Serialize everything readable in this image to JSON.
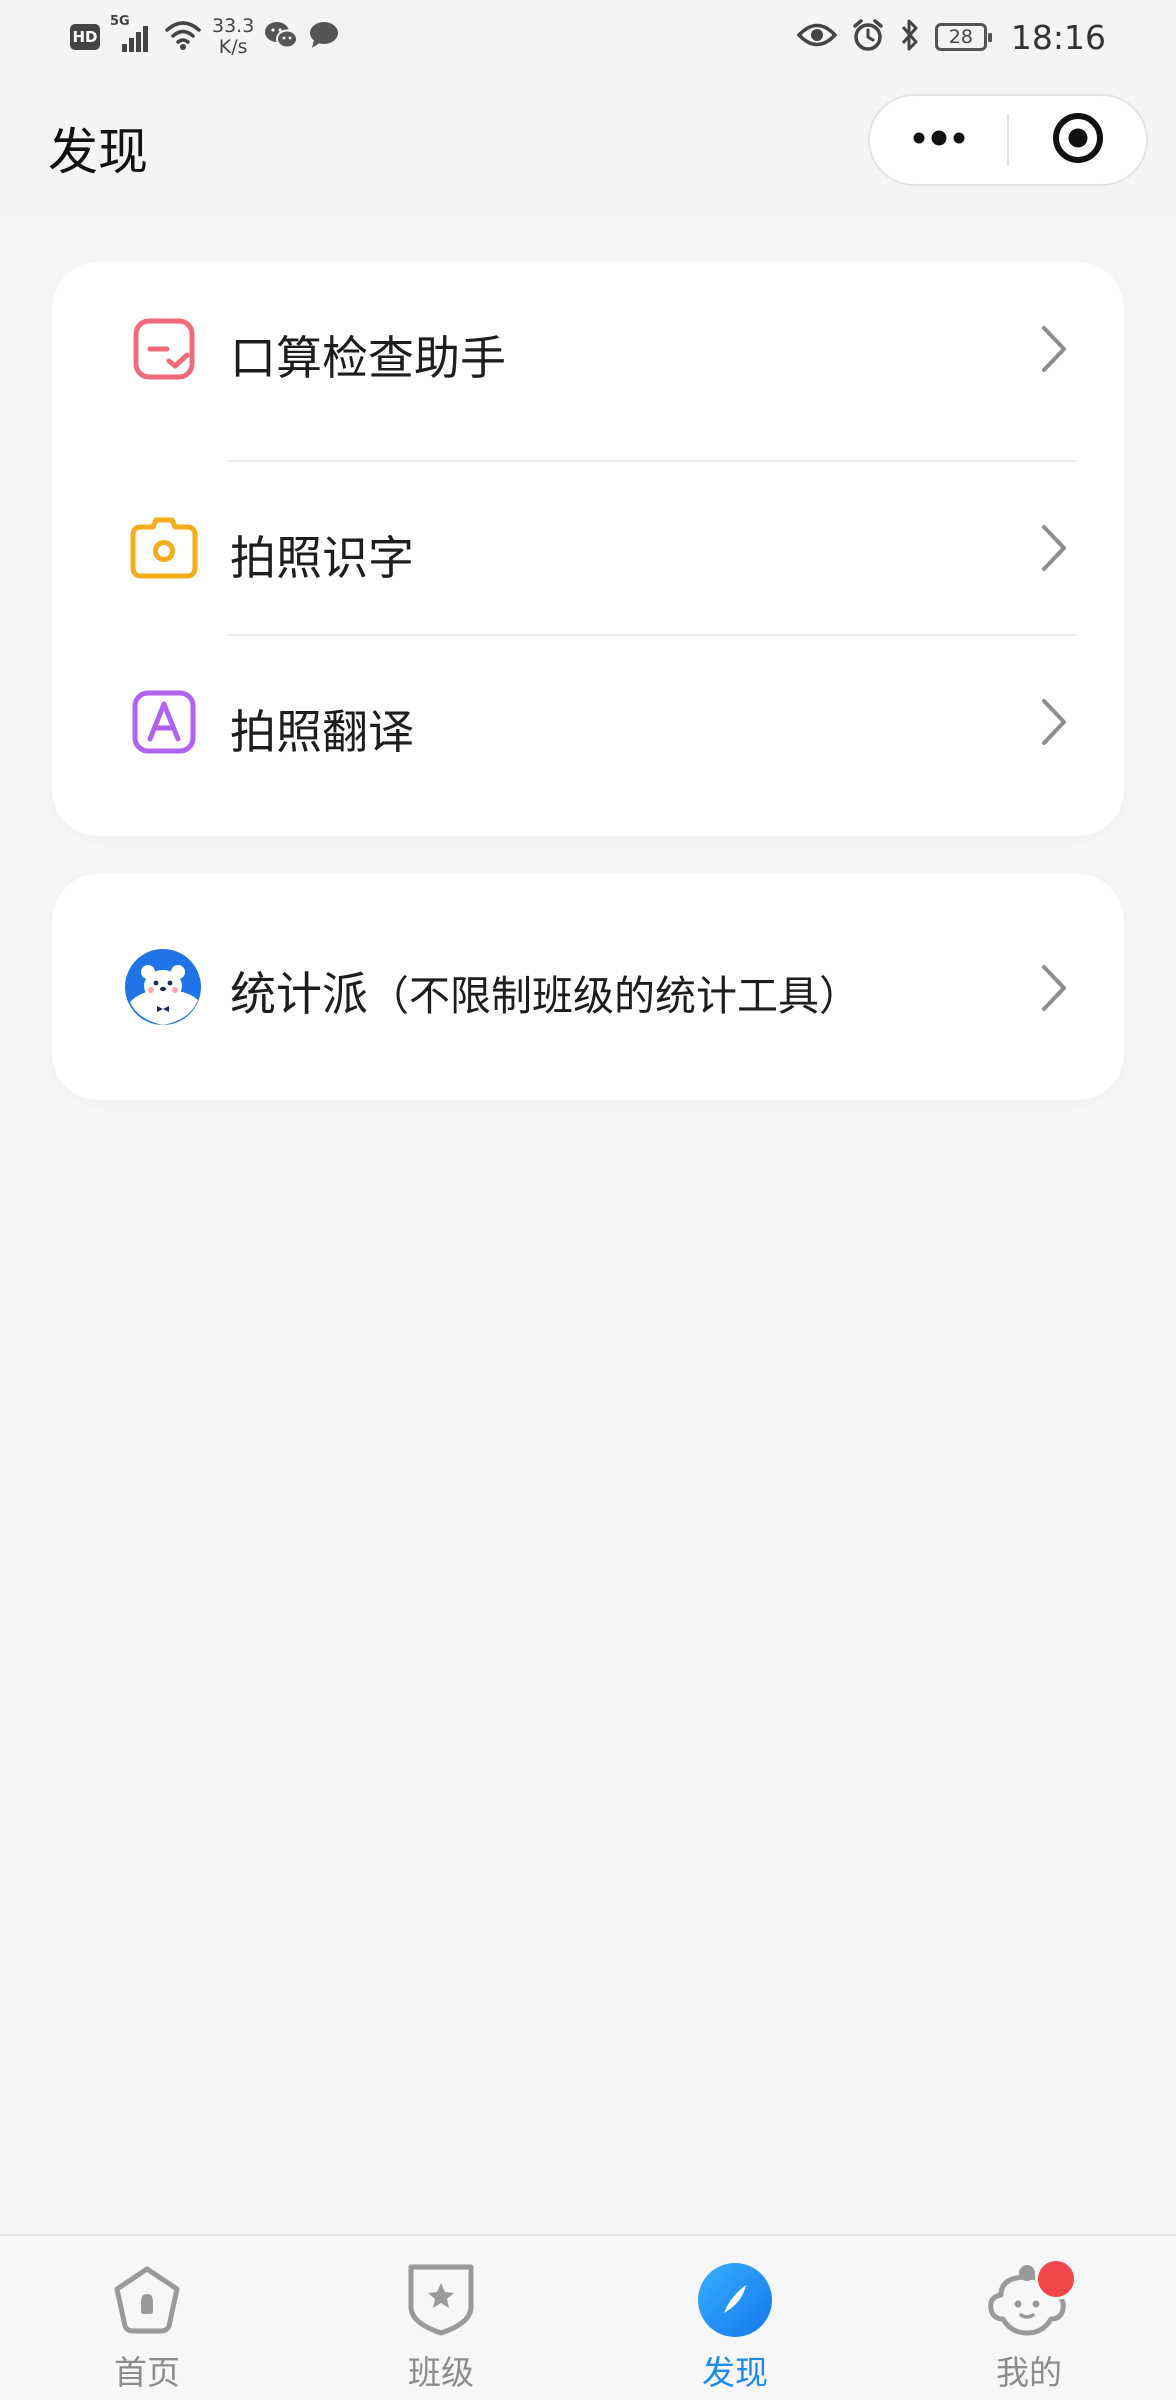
{
  "status_bar": {
    "hd_badge": "HD",
    "network_type": "5G",
    "net_speed_value": "33.3",
    "net_speed_unit": "K/s",
    "battery_level": "28",
    "time": "18:16",
    "icons": [
      "hd-icon",
      "signal-icon",
      "wifi-icon",
      "wechat-icon",
      "message-icon",
      "eye-icon",
      "alarm-icon",
      "bluetooth-icon",
      "battery-icon"
    ]
  },
  "header": {
    "title": "发现",
    "capsule_icons": [
      "more-dots-icon",
      "close-target-icon"
    ]
  },
  "card_tools": {
    "items": [
      {
        "label": "口算检查助手",
        "icon": "oral-math-check-icon",
        "color": "#f26b78"
      },
      {
        "label": "拍照识字",
        "icon": "camera-icon",
        "color": "#f6ad1b"
      },
      {
        "label": "拍照翻译",
        "icon": "translate-a-icon",
        "color": "#b262f0"
      }
    ]
  },
  "card_stats": {
    "label": "统计派",
    "sub_label": "（不限制班级的统计工具）",
    "icon": "bear-mascot-icon"
  },
  "tabbar": {
    "tabs": [
      {
        "label": "首页",
        "icon": "home-icon",
        "active": false
      },
      {
        "label": "班级",
        "icon": "class-badge-icon",
        "active": false
      },
      {
        "label": "发现",
        "icon": "discover-compass-icon",
        "active": true
      },
      {
        "label": "我的",
        "icon": "profile-kid-icon",
        "active": false,
        "badge": true
      }
    ],
    "active_color": "#1c8bf0",
    "inactive_color": "#8c8c8c"
  }
}
